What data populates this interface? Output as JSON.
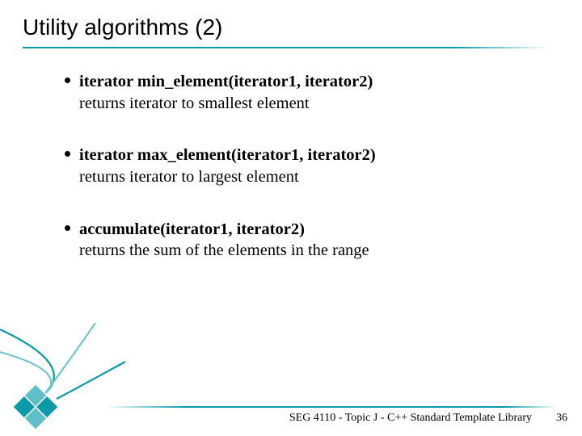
{
  "slide": {
    "title": "Utility algorithms (2)",
    "items": [
      {
        "signature": "iterator min_element(iterator1, iterator2)",
        "description": "returns iterator to smallest element"
      },
      {
        "signature": "iterator max_element(iterator1, iterator2)",
        "description": "returns iterator to largest element"
      },
      {
        "signature": "accumulate(iterator1, iterator2)",
        "description": "returns the sum of the elements in the range"
      }
    ],
    "footer": "SEG 4110 - Topic J - C++ Standard Template Library",
    "page_number": "36"
  },
  "theme": {
    "accent": "#0a9aa8",
    "accent_light": "#6fc7cc"
  }
}
